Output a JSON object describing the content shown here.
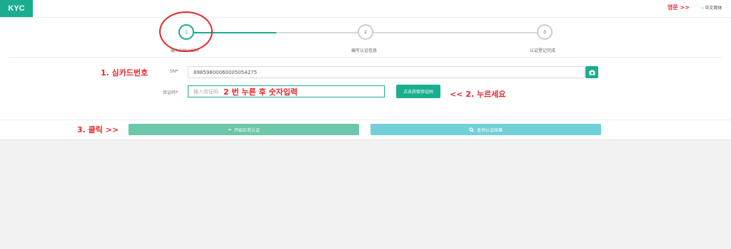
{
  "header": {
    "brand": "KYC",
    "lang_annotation": "영문 >>",
    "lang_switch": "中文简体"
  },
  "steps": [
    {
      "number": "1",
      "label": "输入SIM/eSIM",
      "state": "active"
    },
    {
      "number": "2",
      "label": "编写认证信息",
      "state": "pending"
    },
    {
      "number": "3",
      "label": "认证登记完成",
      "state": "pending"
    }
  ],
  "annotations": {
    "sim_card_number": "1. 심카드번호",
    "enter_code": "2 번 누른 후 숫자입력",
    "press": "<< 2. 누르세요",
    "click": "3. 클릭 >>"
  },
  "form": {
    "sn_label": "SN",
    "sn_required": "*",
    "sn_value": "89859800060005054275",
    "code_label": "验证码",
    "code_required": "*",
    "code_placeholder": "输入验证码",
    "get_code_button": "点击获取验证码"
  },
  "actions": {
    "start_button": "开始实名认证",
    "query_button": "查询认证结果"
  },
  "colors": {
    "brand": "#1aae8f",
    "annotation": "#e8262b",
    "query_button": "#71d0d8",
    "start_button": "#6cc7ac"
  }
}
